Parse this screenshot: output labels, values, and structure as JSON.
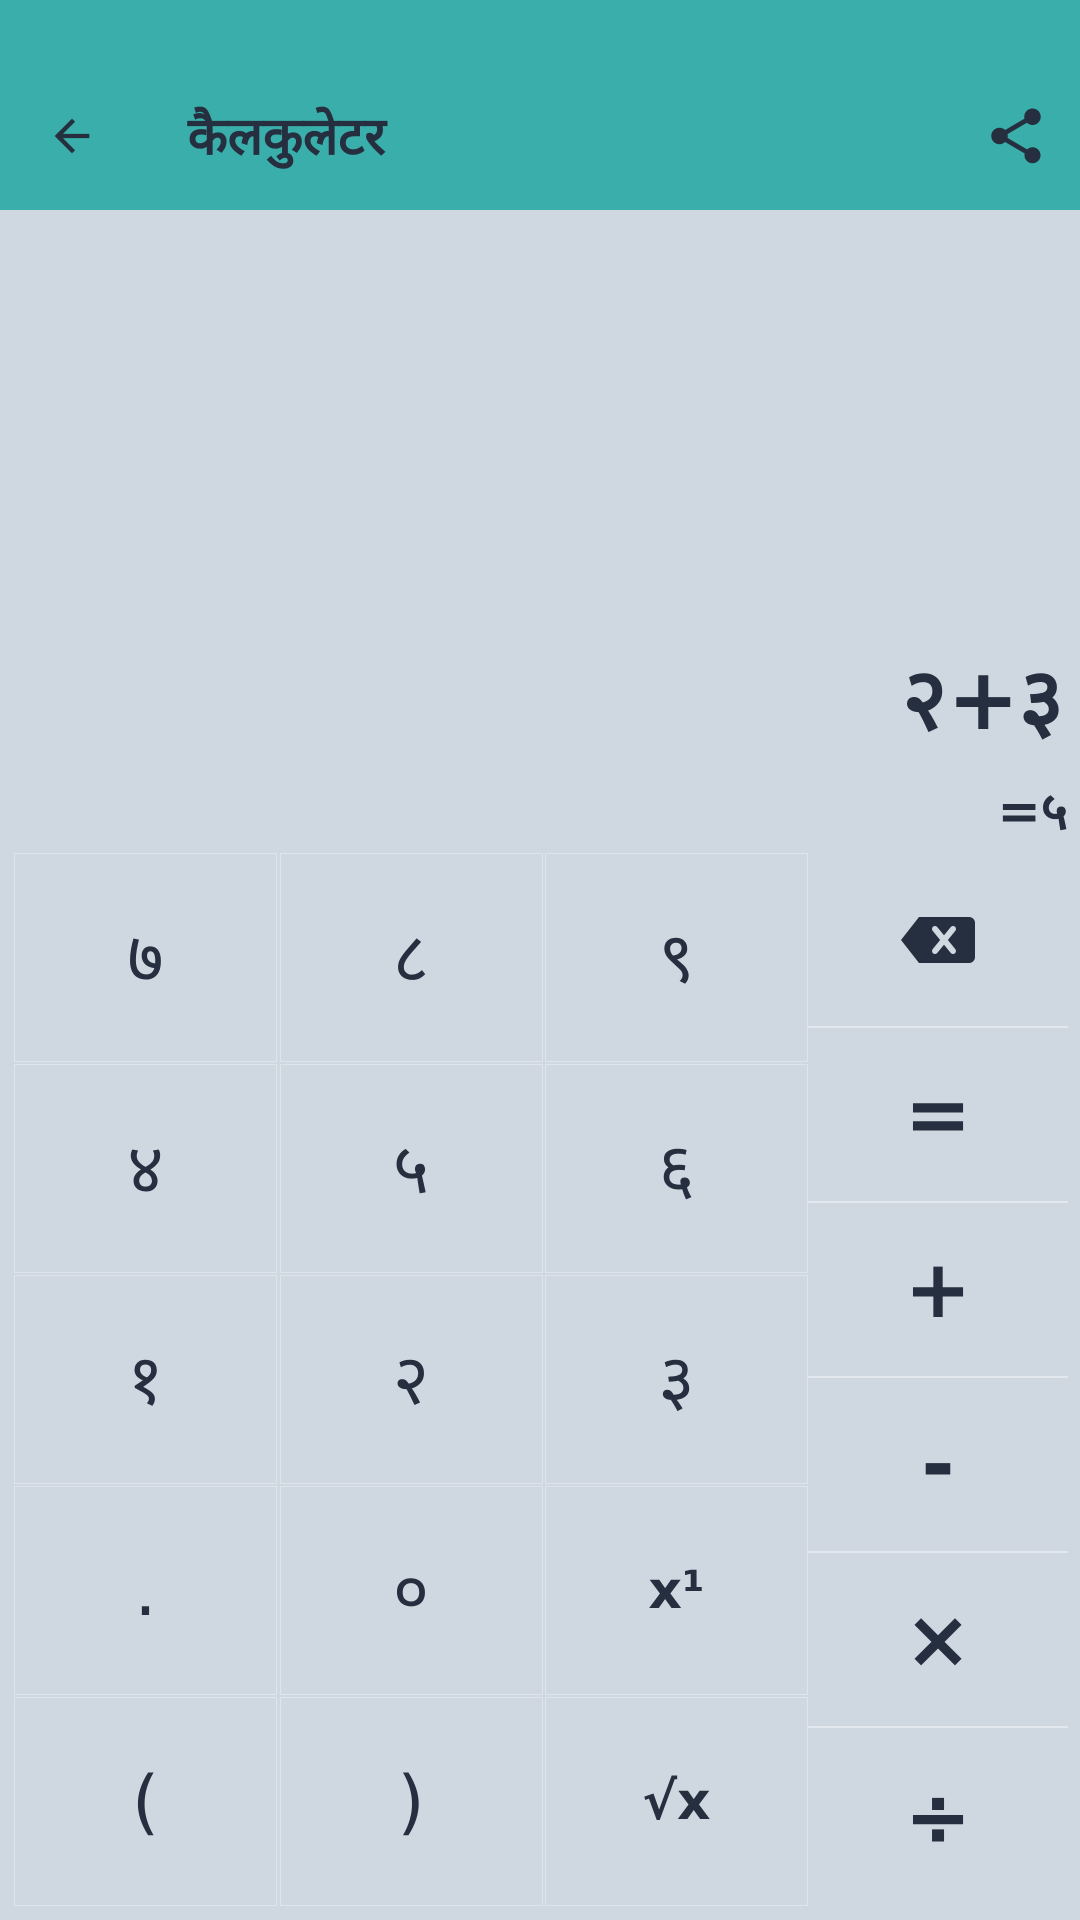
{
  "app_bar": {
    "title": "कैलकुलेटर",
    "back_icon": "arrow-left-icon",
    "share_icon": "share-icon",
    "background_color": "#3aaeaa"
  },
  "display": {
    "expression": "२+३",
    "result": "=५"
  },
  "keypad": {
    "row1": [
      "७",
      "८",
      "९"
    ],
    "row2": [
      "४",
      "५",
      "६"
    ],
    "row3": [
      "१",
      "२",
      "३"
    ],
    "row4": [
      ".",
      "०",
      "x¹"
    ],
    "row5": [
      "(",
      ")",
      "√x"
    ]
  },
  "operators": {
    "backspace_icon": "backspace-icon",
    "equals": "=",
    "plus": "+",
    "minus": "-",
    "multiply": "×",
    "divide": "÷"
  }
}
